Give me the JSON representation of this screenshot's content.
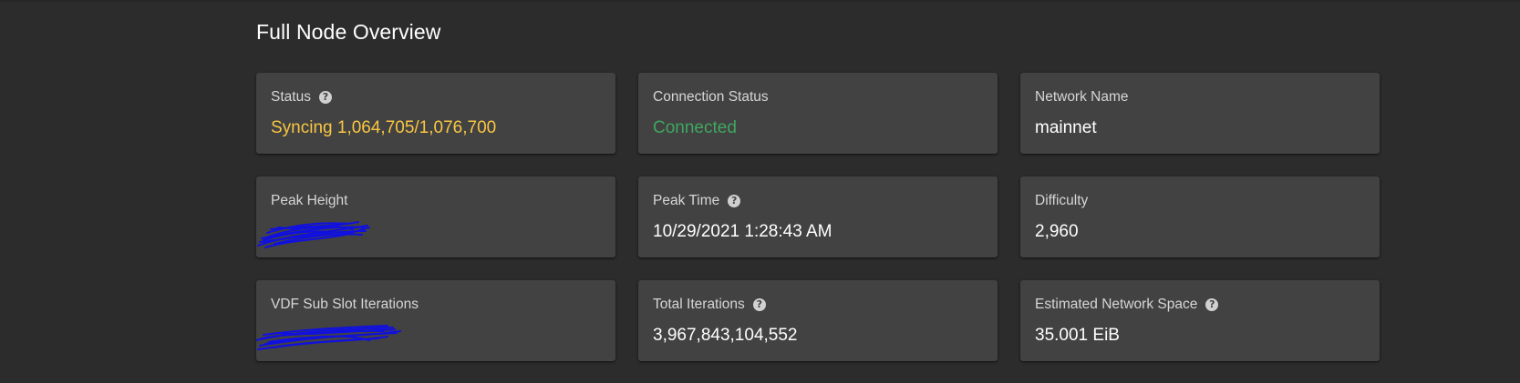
{
  "page": {
    "title": "Full Node Overview"
  },
  "colors": {
    "background": "#2c2c2c",
    "card": "#424242",
    "label": "#d6d6d6",
    "value": "#ffffff",
    "syncing": "#f9c642",
    "connected": "#3fa65f",
    "redaction": "#1010e0"
  },
  "cards": [
    {
      "label": "Status",
      "value": "Syncing 1,064,705/1,076,700",
      "help": true,
      "help_icon": "help-circle-icon",
      "value_color": "#f9c642"
    },
    {
      "label": "Connection Status",
      "value": "Connected",
      "help": false,
      "value_color": "#3fa65f"
    },
    {
      "label": "Network Name",
      "value": "mainnet",
      "help": false,
      "value_color": "#ffffff"
    },
    {
      "label": "Peak Height",
      "value": "",
      "help": false,
      "redacted": true
    },
    {
      "label": "Peak Time",
      "value": "10/29/2021 1:28:43 AM",
      "help": true,
      "help_icon": "help-circle-icon",
      "value_color": "#ffffff"
    },
    {
      "label": "Difficulty",
      "value": "2,960",
      "help": false,
      "value_color": "#ffffff"
    },
    {
      "label": "VDF Sub Slot Iterations",
      "value": "",
      "help": false,
      "redacted": true
    },
    {
      "label": "Total Iterations",
      "value": "3,967,843,104,552",
      "help": true,
      "help_icon": "help-circle-icon",
      "value_color": "#ffffff"
    },
    {
      "label": "Estimated Network Space",
      "value": "35.001 EiB",
      "help": true,
      "help_icon": "help-circle-icon",
      "value_color": "#ffffff"
    }
  ]
}
